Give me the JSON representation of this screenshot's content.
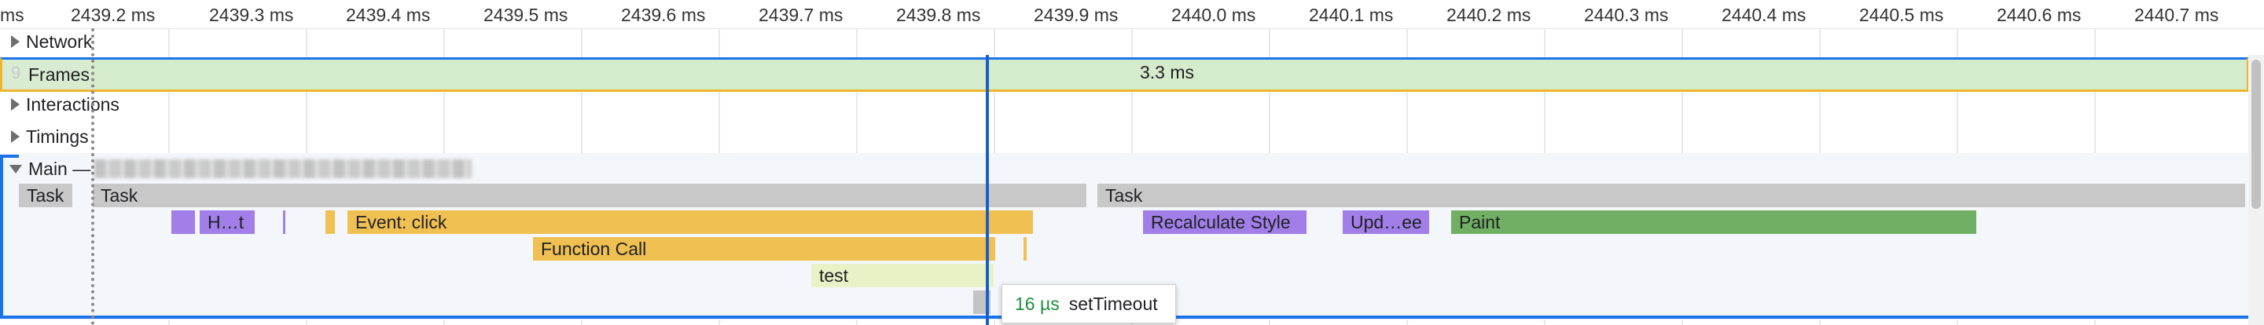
{
  "ruler": {
    "ticks": [
      "ms",
      "2439.2 ms",
      "2439.3 ms",
      "2439.4 ms",
      "2439.5 ms",
      "2439.6 ms",
      "2439.7 ms",
      "2439.8 ms",
      "2439.9 ms",
      "2440.0 ms",
      "2440.1 ms",
      "2440.2 ms",
      "2440.3 ms",
      "2440.4 ms",
      "2440.5 ms",
      "2440.6 ms",
      "2440.7 ms"
    ]
  },
  "tracks": {
    "network": "Network",
    "frames": "Frames",
    "frames_ghost": "9",
    "frames_duration": "3.3 ms",
    "interactions": "Interactions",
    "timings": "Timings",
    "main": "Main —"
  },
  "events": {
    "task_1": "Task",
    "task_2": "Task",
    "task_3": "Task",
    "h_t": "H…t",
    "event_click": "Event: click",
    "function_call": "Function Call",
    "test": "test",
    "recalculate_style": "Recalculate Style",
    "update_tree": "Upd…ee",
    "paint": "Paint"
  },
  "tooltip": {
    "duration": "16 µs",
    "name": "setTimeout"
  },
  "colors": {
    "task": "#c8c8c8",
    "scripting": "#f1c052",
    "rendering": "#a17ee8",
    "painting": "#71b064",
    "selection": "#1a73e8"
  }
}
